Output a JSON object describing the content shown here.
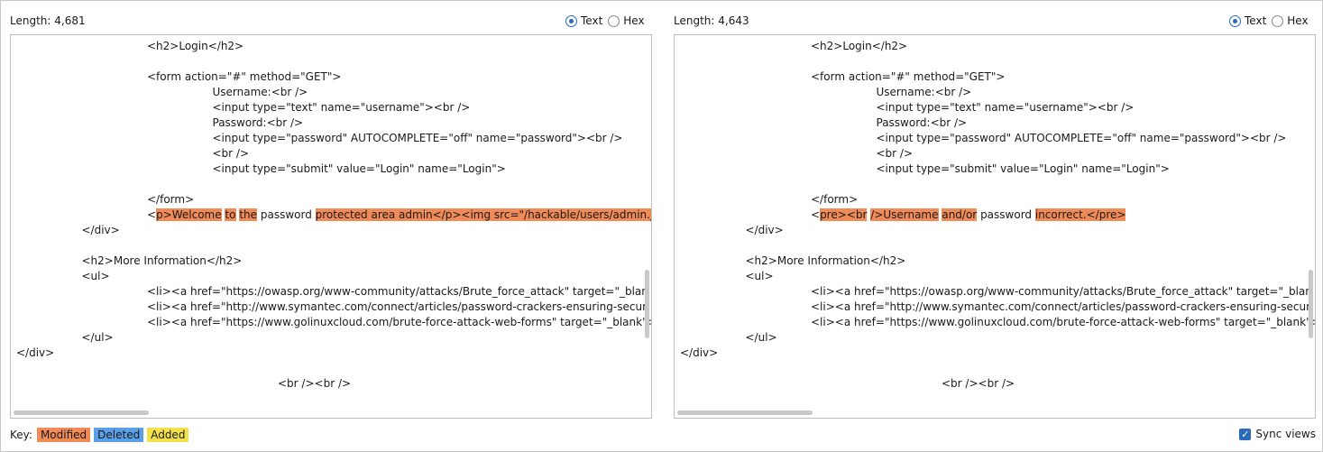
{
  "left": {
    "length_label": "Length: 4,681",
    "mode_text": "Text",
    "mode_hex": "Hex",
    "lines": [
      {
        "indent": 20,
        "segs": [
          {
            "t": "<h2>Login</h2>"
          }
        ]
      },
      {
        "indent": 0,
        "segs": []
      },
      {
        "indent": 20,
        "segs": [
          {
            "t": "<form action=\"#\" method=\"GET\">"
          }
        ]
      },
      {
        "indent": 30,
        "segs": [
          {
            "t": "Username:<br />"
          }
        ]
      },
      {
        "indent": 30,
        "segs": [
          {
            "t": "<input type=\"text\" name=\"username\"><br />"
          }
        ]
      },
      {
        "indent": 30,
        "segs": [
          {
            "t": "Password:<br />"
          }
        ]
      },
      {
        "indent": 30,
        "segs": [
          {
            "t": "<input type=\"password\" AUTOCOMPLETE=\"off\" name=\"password\"><br />"
          }
        ]
      },
      {
        "indent": 30,
        "segs": [
          {
            "t": "<br />"
          }
        ]
      },
      {
        "indent": 30,
        "segs": [
          {
            "t": "<input type=\"submit\" value=\"Login\" name=\"Login\">"
          }
        ]
      },
      {
        "indent": 0,
        "segs": []
      },
      {
        "indent": 20,
        "segs": [
          {
            "t": "</form>"
          }
        ]
      },
      {
        "indent": 20,
        "segs": [
          {
            "t": "<"
          },
          {
            "t": "p>Welcome",
            "d": 1
          },
          {
            "t": " "
          },
          {
            "t": "to",
            "d": 1
          },
          {
            "t": " "
          },
          {
            "t": "the",
            "d": 1
          },
          {
            "t": " password "
          },
          {
            "t": "protected area admin</p><img src=\"/hackable/users/admin.j",
            "d": 1
          }
        ]
      },
      {
        "indent": 10,
        "segs": [
          {
            "t": "</div>"
          }
        ]
      },
      {
        "indent": 0,
        "segs": []
      },
      {
        "indent": 10,
        "segs": [
          {
            "t": "<h2>More Information</h2>"
          }
        ]
      },
      {
        "indent": 10,
        "segs": [
          {
            "t": "<ul>"
          }
        ]
      },
      {
        "indent": 20,
        "segs": [
          {
            "t": "<li><a href=\"https://owasp.org/www-community/attacks/Brute_force_attack\" target=\"_blan"
          }
        ]
      },
      {
        "indent": 20,
        "segs": [
          {
            "t": "<li><a href=\"http://www.symantec.com/connect/articles/password-crackers-ensuring-secur"
          }
        ]
      },
      {
        "indent": 20,
        "segs": [
          {
            "t": "<li><a href=\"https://www.golinuxcloud.com/brute-force-attack-web-forms\" target=\"_blank\">"
          }
        ]
      },
      {
        "indent": 10,
        "segs": [
          {
            "t": "</ul>"
          }
        ]
      },
      {
        "indent": 0,
        "segs": [
          {
            "t": "</div>"
          }
        ]
      },
      {
        "indent": 0,
        "segs": []
      },
      {
        "indent": 40,
        "segs": [
          {
            "t": "<br /><br />"
          }
        ]
      }
    ]
  },
  "right": {
    "length_label": "Length: 4,643",
    "mode_text": "Text",
    "mode_hex": "Hex",
    "lines": [
      {
        "indent": 20,
        "segs": [
          {
            "t": "<h2>Login</h2>"
          }
        ]
      },
      {
        "indent": 0,
        "segs": []
      },
      {
        "indent": 20,
        "segs": [
          {
            "t": "<form action=\"#\" method=\"GET\">"
          }
        ]
      },
      {
        "indent": 30,
        "segs": [
          {
            "t": "Username:<br />"
          }
        ]
      },
      {
        "indent": 30,
        "segs": [
          {
            "t": "<input type=\"text\" name=\"username\"><br />"
          }
        ]
      },
      {
        "indent": 30,
        "segs": [
          {
            "t": "Password:<br />"
          }
        ]
      },
      {
        "indent": 30,
        "segs": [
          {
            "t": "<input type=\"password\" AUTOCOMPLETE=\"off\" name=\"password\"><br />"
          }
        ]
      },
      {
        "indent": 30,
        "segs": [
          {
            "t": "<br />"
          }
        ]
      },
      {
        "indent": 30,
        "segs": [
          {
            "t": "<input type=\"submit\" value=\"Login\" name=\"Login\">"
          }
        ]
      },
      {
        "indent": 0,
        "segs": []
      },
      {
        "indent": 20,
        "segs": [
          {
            "t": "</form>"
          }
        ]
      },
      {
        "indent": 20,
        "segs": [
          {
            "t": "<"
          },
          {
            "t": "pre><br",
            "d": 1
          },
          {
            "t": " "
          },
          {
            "t": "/>Username",
            "d": 1
          },
          {
            "t": " "
          },
          {
            "t": "and/or",
            "d": 1
          },
          {
            "t": " password "
          },
          {
            "t": "incorrect.</pre>",
            "d": 1
          }
        ]
      },
      {
        "indent": 10,
        "segs": [
          {
            "t": "</div>"
          }
        ]
      },
      {
        "indent": 0,
        "segs": []
      },
      {
        "indent": 10,
        "segs": [
          {
            "t": "<h2>More Information</h2>"
          }
        ]
      },
      {
        "indent": 10,
        "segs": [
          {
            "t": "<ul>"
          }
        ]
      },
      {
        "indent": 20,
        "segs": [
          {
            "t": "<li><a href=\"https://owasp.org/www-community/attacks/Brute_force_attack\" target=\"_blan"
          }
        ]
      },
      {
        "indent": 20,
        "segs": [
          {
            "t": "<li><a href=\"http://www.symantec.com/connect/articles/password-crackers-ensuring-secur"
          }
        ]
      },
      {
        "indent": 20,
        "segs": [
          {
            "t": "<li><a href=\"https://www.golinuxcloud.com/brute-force-attack-web-forms\" target=\"_blank\">"
          }
        ]
      },
      {
        "indent": 10,
        "segs": [
          {
            "t": "</ul>"
          }
        ]
      },
      {
        "indent": 0,
        "segs": [
          {
            "t": "</div>"
          }
        ]
      },
      {
        "indent": 0,
        "segs": []
      },
      {
        "indent": 40,
        "segs": [
          {
            "t": "<br /><br />"
          }
        ]
      }
    ]
  },
  "key": {
    "label": "Key:",
    "modified": "Modified",
    "deleted": "Deleted",
    "added": "Added",
    "modified_color": "#f08a57",
    "deleted_color": "#5aa0e8",
    "added_color": "#f3e14b"
  },
  "sync_views": {
    "label": "Sync views",
    "checked": true
  }
}
